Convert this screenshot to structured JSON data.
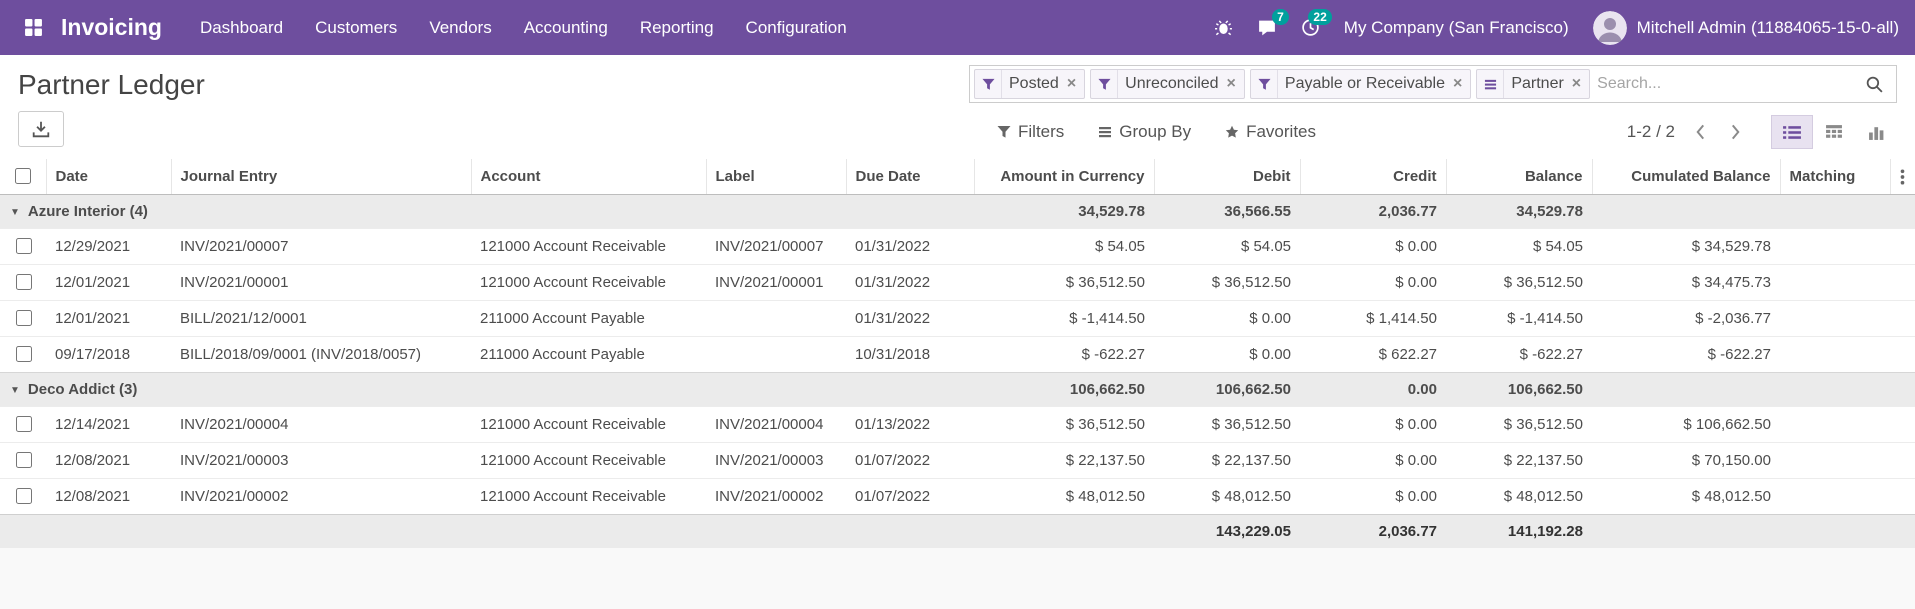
{
  "colors": {
    "accent": "#6e4e9e",
    "badge": "#00a09d"
  },
  "app": {
    "name": "Invoicing",
    "menus": [
      "Dashboard",
      "Customers",
      "Vendors",
      "Accounting",
      "Reporting",
      "Configuration"
    ],
    "badges": {
      "messages": "7",
      "activities": "22"
    },
    "company": "My Company (San Francisco)",
    "user": "Mitchell Admin (11884065-15-0-all)"
  },
  "page": {
    "title": "Partner Ledger"
  },
  "search": {
    "facets": [
      {
        "label": "Posted",
        "icon": "filter-icon"
      },
      {
        "label": "Unreconciled",
        "icon": "filter-icon"
      },
      {
        "label": "Payable or Receivable",
        "icon": "filter-icon"
      },
      {
        "label": "Partner",
        "icon": "group-by-icon"
      }
    ],
    "placeholder": "Search...",
    "remove_label": "×"
  },
  "toolbar": {
    "filters_label": "Filters",
    "group_by_label": "Group By",
    "favorites_label": "Favorites",
    "pager": "1-2 / 2"
  },
  "table": {
    "columns": [
      "Date",
      "Journal Entry",
      "Account",
      "Label",
      "Due Date",
      "Amount in Currency",
      "Debit",
      "Credit",
      "Balance",
      "Cumulated Balance",
      "Matching"
    ],
    "groups": [
      {
        "label": "Azure Interior (4)",
        "amount_currency": "34,529.78",
        "debit": "36,566.55",
        "credit": "2,036.77",
        "balance": "34,529.78",
        "rows": [
          {
            "date": "12/29/2021",
            "journal": "INV/2021/00007",
            "account": "121000 Account Receivable",
            "label": "INV/2021/00007",
            "due": "01/31/2022",
            "amount": "$ 54.05",
            "debit": "$ 54.05",
            "credit": "$ 0.00",
            "balance": "$ 54.05",
            "cumulated": "$ 34,529.78",
            "matching": ""
          },
          {
            "date": "12/01/2021",
            "journal": "INV/2021/00001",
            "account": "121000 Account Receivable",
            "label": "INV/2021/00001",
            "due": "01/31/2022",
            "amount": "$ 36,512.50",
            "debit": "$ 36,512.50",
            "credit": "$ 0.00",
            "balance": "$ 36,512.50",
            "cumulated": "$ 34,475.73",
            "matching": ""
          },
          {
            "date": "12/01/2021",
            "journal": "BILL/2021/12/0001",
            "account": "211000 Account Payable",
            "label": "",
            "due": "01/31/2022",
            "amount": "$ -1,414.50",
            "debit": "$ 0.00",
            "credit": "$ 1,414.50",
            "balance": "$ -1,414.50",
            "cumulated": "$ -2,036.77",
            "matching": ""
          },
          {
            "date": "09/17/2018",
            "journal": "BILL/2018/09/0001 (INV/2018/0057)",
            "account": "211000 Account Payable",
            "label": "",
            "due": "10/31/2018",
            "amount": "$ -622.27",
            "debit": "$ 0.00",
            "credit": "$ 622.27",
            "balance": "$ -622.27",
            "cumulated": "$ -622.27",
            "matching": ""
          }
        ]
      },
      {
        "label": "Deco Addict (3)",
        "amount_currency": "106,662.50",
        "debit": "106,662.50",
        "credit": "0.00",
        "balance": "106,662.50",
        "rows": [
          {
            "date": "12/14/2021",
            "journal": "INV/2021/00004",
            "account": "121000 Account Receivable",
            "label": "INV/2021/00004",
            "due": "01/13/2022",
            "amount": "$ 36,512.50",
            "debit": "$ 36,512.50",
            "credit": "$ 0.00",
            "balance": "$ 36,512.50",
            "cumulated": "$ 106,662.50",
            "matching": ""
          },
          {
            "date": "12/08/2021",
            "journal": "INV/2021/00003",
            "account": "121000 Account Receivable",
            "label": "INV/2021/00003",
            "due": "01/07/2022",
            "amount": "$ 22,137.50",
            "debit": "$ 22,137.50",
            "credit": "$ 0.00",
            "balance": "$ 22,137.50",
            "cumulated": "$ 70,150.00",
            "matching": ""
          },
          {
            "date": "12/08/2021",
            "journal": "INV/2021/00002",
            "account": "121000 Account Receivable",
            "label": "INV/2021/00002",
            "due": "01/07/2022",
            "amount": "$ 48,012.50",
            "debit": "$ 48,012.50",
            "credit": "$ 0.00",
            "balance": "$ 48,012.50",
            "cumulated": "$ 48,012.50",
            "matching": ""
          }
        ]
      }
    ],
    "total": {
      "debit": "143,229.05",
      "credit": "2,036.77",
      "balance": "141,192.28"
    }
  }
}
